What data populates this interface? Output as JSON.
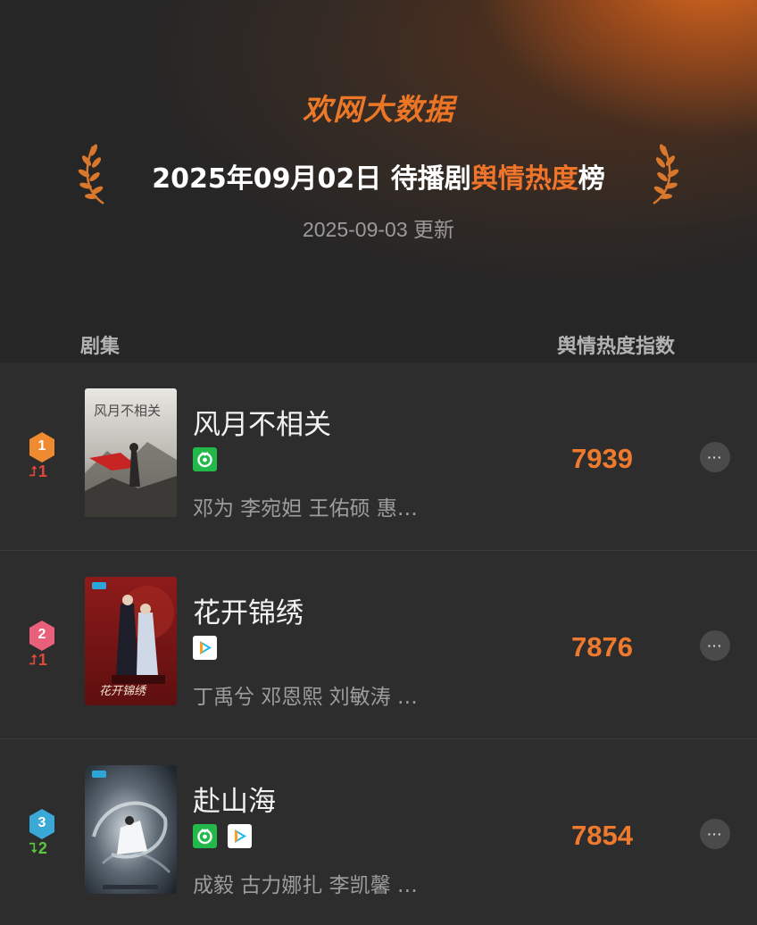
{
  "header": {
    "brand": "欢网大数据",
    "title_prefix": "2025年09月02日 待播剧",
    "title_highlight": "舆情热度",
    "title_suffix": "榜",
    "updated": "2025-09-03 更新",
    "accent_color": "#f0742a"
  },
  "columns": {
    "left": "剧集",
    "right": "舆情热度指数"
  },
  "rows": [
    {
      "rank": "1",
      "rank_color": "#f08a30",
      "change_dir": "up",
      "change_value": "1",
      "title": "风月不相关",
      "platforms": [
        "iqiyi-icon"
      ],
      "cast": "邓为 李宛妲 王佑硕 惠…",
      "score": "7939",
      "poster_text": "风月不相关"
    },
    {
      "rank": "2",
      "rank_color": "#e8607a",
      "change_dir": "up",
      "change_value": "1",
      "title": "花开锦绣",
      "platforms": [
        "tencent-video-icon"
      ],
      "cast": "丁禹兮 邓恩熙 刘敏涛 …",
      "score": "7876",
      "poster_text": "花开锦绣"
    },
    {
      "rank": "3",
      "rank_color": "#3aa9d8",
      "change_dir": "down",
      "change_value": "2",
      "title": "赴山海",
      "platforms": [
        "iqiyi-icon",
        "tencent-video-icon"
      ],
      "cast": "成毅 古力娜扎 李凯馨 …",
      "score": "7854",
      "poster_text": ""
    }
  ],
  "more_label": "···"
}
